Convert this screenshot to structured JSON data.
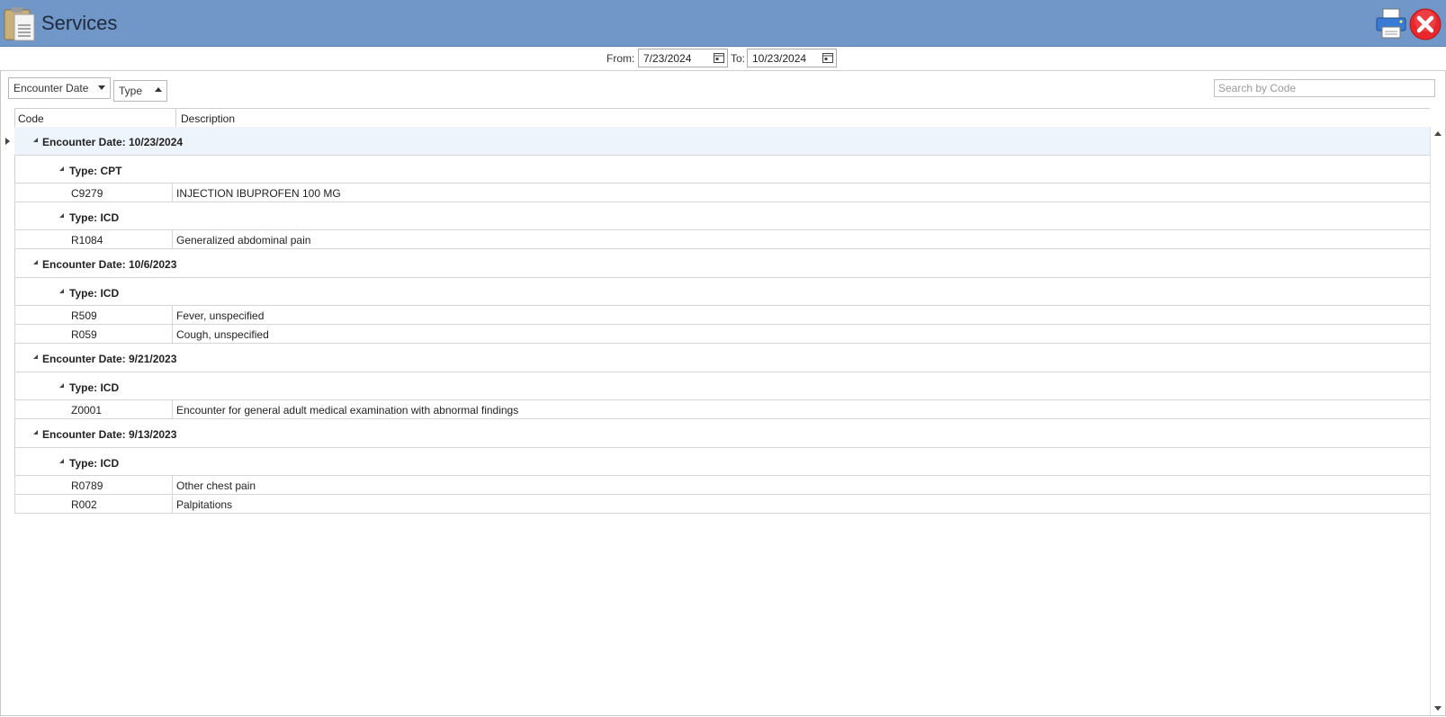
{
  "window": {
    "title": "Services"
  },
  "colors": {
    "titlebar": "#7097c8",
    "close": "#e8262c",
    "selected_row": "#eef4fb"
  },
  "icons": {
    "app": "clipboard-icon",
    "print": "printer-icon",
    "close": "close-icon",
    "calendar": "calendar-icon"
  },
  "filters": {
    "from_label": "From:",
    "from_value": "7/23/2024",
    "to_label": "To:",
    "to_value": "10/23/2024"
  },
  "grouping": {
    "chips": [
      {
        "label": "Encounter Date",
        "sort": "desc"
      },
      {
        "label": "Type",
        "sort": "asc"
      }
    ]
  },
  "search": {
    "placeholder": "Search by Code"
  },
  "columns": {
    "code": "Code",
    "description": "Description"
  },
  "groups": [
    {
      "label": "Encounter Date: 10/23/2024",
      "types": [
        {
          "label": "Type: CPT",
          "rows": [
            {
              "code": "C9279",
              "description": "INJECTION IBUPROFEN 100 MG"
            }
          ]
        },
        {
          "label": "Type: ICD",
          "rows": [
            {
              "code": "R1084",
              "description": "Generalized abdominal pain"
            }
          ]
        }
      ]
    },
    {
      "label": "Encounter Date: 10/6/2023",
      "types": [
        {
          "label": "Type: ICD",
          "rows": [
            {
              "code": "R509",
              "description": "Fever, unspecified"
            },
            {
              "code": "R059",
              "description": "Cough, unspecified"
            }
          ]
        }
      ]
    },
    {
      "label": "Encounter Date: 9/21/2023",
      "types": [
        {
          "label": "Type: ICD",
          "rows": [
            {
              "code": "Z0001",
              "description": "Encounter for general adult medical examination with abnormal findings"
            }
          ]
        }
      ]
    },
    {
      "label": "Encounter Date: 9/13/2023",
      "types": [
        {
          "label": "Type: ICD",
          "rows": [
            {
              "code": "R0789",
              "description": "Other chest pain"
            },
            {
              "code": "R002",
              "description": "Palpitations"
            }
          ]
        }
      ]
    }
  ]
}
